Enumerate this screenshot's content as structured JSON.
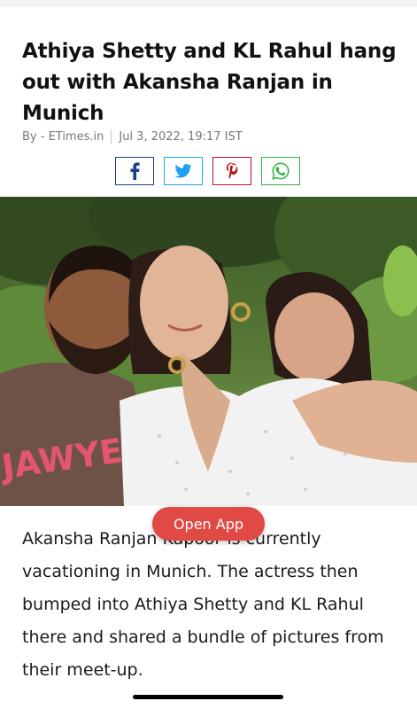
{
  "article": {
    "headline": "Athiya Shetty and KL Rahul hang out with Akansha Ranjan in Munich",
    "byline_source": "By - ETimes.in",
    "byline_date": "Jul 3, 2022, 19:17 IST",
    "image_shirt_text": "JAWYE",
    "body_text": "Akansha Ranjan Kapoor is currently vacationing in Munich. The actress then bumped into Athiya Shetty and KL Rahul there and shared a bundle of pictures from their meet-up."
  },
  "share": {
    "buttons": [
      {
        "name": "facebook",
        "icon": "facebook-icon",
        "color": "#1d3f86"
      },
      {
        "name": "twitter",
        "icon": "twitter-icon",
        "color": "#1da1f2"
      },
      {
        "name": "pinterest",
        "icon": "pinterest-icon",
        "color": "#b8141b"
      },
      {
        "name": "whatsapp",
        "icon": "whatsapp-icon",
        "color": "#2fb344"
      }
    ]
  },
  "cta": {
    "open_app_label": "Open App",
    "color": "#e14a44"
  }
}
